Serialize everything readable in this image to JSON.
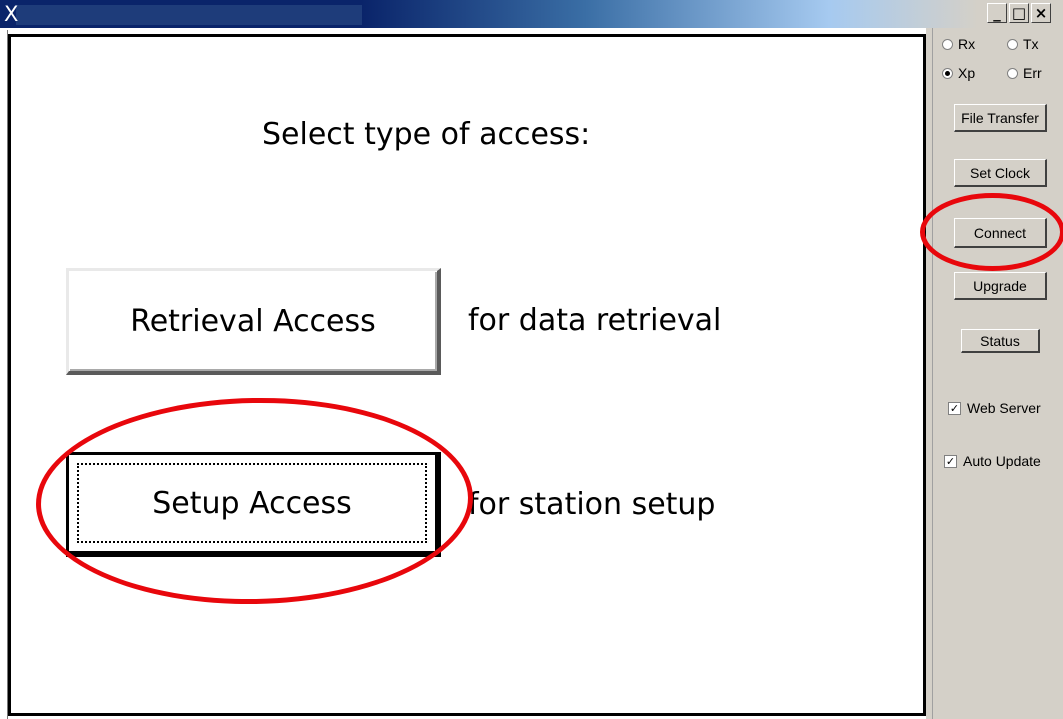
{
  "window": {
    "app_letter": "X",
    "minimize_label": "_",
    "maximize_label": "□",
    "close_label": "×"
  },
  "main": {
    "heading": "Select type of access:",
    "retrieval_button_label": "Retrieval Access",
    "retrieval_description": "for data retrieval",
    "setup_button_label": "Setup Access",
    "setup_description": "for station setup"
  },
  "side": {
    "radios": [
      {
        "label": "Rx",
        "checked": false
      },
      {
        "label": "Tx",
        "checked": false
      },
      {
        "label": "Xp",
        "checked": true
      },
      {
        "label": "Err",
        "checked": false
      }
    ],
    "buttons": {
      "file_transfer": "File Transfer",
      "set_clock": "Set Clock",
      "connect": "Connect",
      "upgrade": "Upgrade",
      "status": "Status"
    },
    "checkboxes": [
      {
        "label": "Web Server",
        "checked": true
      },
      {
        "label": "Auto Update",
        "checked": true
      }
    ]
  },
  "annotation_color": "#e8070c"
}
